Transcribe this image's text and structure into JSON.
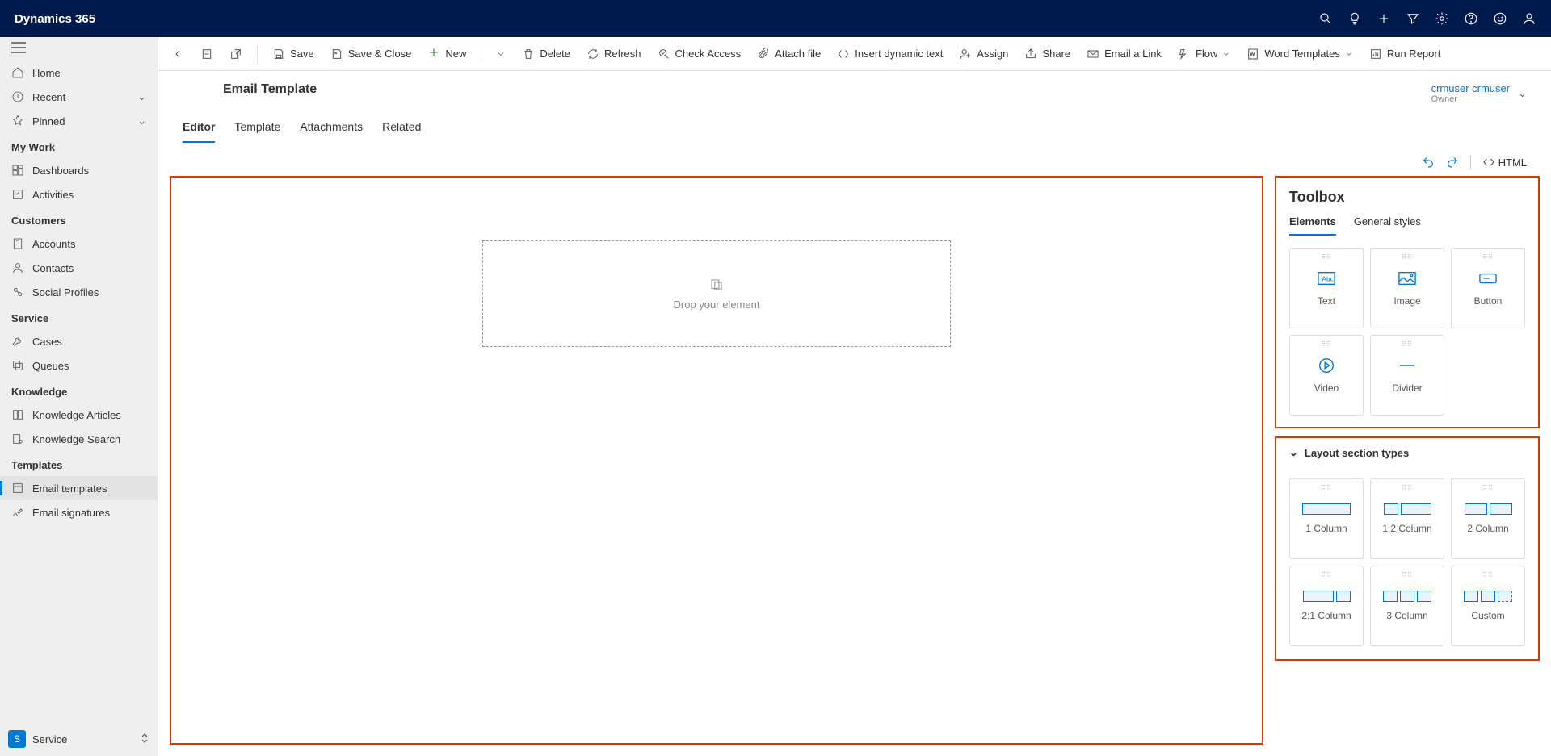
{
  "brand": "Dynamics 365",
  "sidebar": {
    "top": [
      {
        "label": "Home"
      },
      {
        "label": "Recent",
        "expandable": true
      },
      {
        "label": "Pinned",
        "expandable": true
      }
    ],
    "groups": [
      {
        "title": "My Work",
        "items": [
          "Dashboards",
          "Activities"
        ]
      },
      {
        "title": "Customers",
        "items": [
          "Accounts",
          "Contacts",
          "Social Profiles"
        ]
      },
      {
        "title": "Service",
        "items": [
          "Cases",
          "Queues"
        ]
      },
      {
        "title": "Knowledge",
        "items": [
          "Knowledge Articles",
          "Knowledge Search"
        ]
      },
      {
        "title": "Templates",
        "items": [
          "Email templates",
          "Email signatures"
        ]
      }
    ],
    "selected": "Email templates",
    "app": "Service",
    "app_initial": "S"
  },
  "commandbar": [
    "Save",
    "Save & Close",
    "New",
    "Delete",
    "Refresh",
    "Check Access",
    "Attach file",
    "Insert dynamic text",
    "Assign",
    "Share",
    "Email a Link",
    "Flow",
    "Word Templates",
    "Run Report"
  ],
  "header": {
    "title": "Email Template",
    "owner_name": "crmuser crmuser",
    "owner_label": "Owner"
  },
  "tabs": [
    "Editor",
    "Template",
    "Attachments",
    "Related"
  ],
  "active_tab": "Editor",
  "editor_toolbar": {
    "html": "HTML"
  },
  "canvas": {
    "drop_text": "Drop your element"
  },
  "toolbox": {
    "title": "Toolbox",
    "tabs": [
      "Elements",
      "General styles"
    ],
    "active": "Elements",
    "elements": [
      "Text",
      "Image",
      "Button",
      "Video",
      "Divider"
    ]
  },
  "sections": {
    "title": "Layout section types",
    "items": [
      "1 Column",
      "1:2 Column",
      "2 Column",
      "2:1 Column",
      "3 Column",
      "Custom"
    ]
  }
}
